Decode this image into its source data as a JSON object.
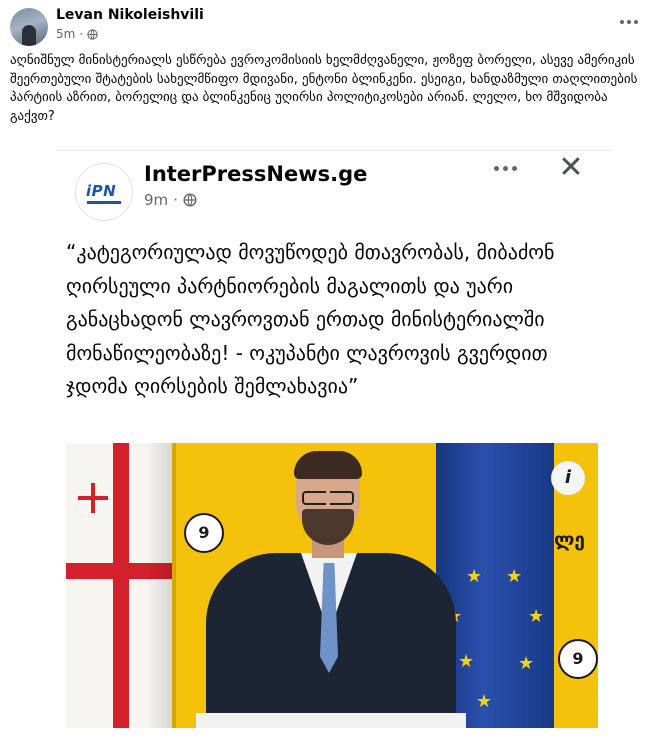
{
  "post": {
    "author": "Levan Nikoleishvili",
    "time": "5m",
    "text": "აღნიშნულ მინისტერიალს ესწრება ევროკომისიის ხელმძღვანელი, ჟოზეფ ბორელი, ასევე ამერიკის შეერთებული შტატების სახელმწიფო მდივანი, ენტონი ბლინკენი. ესეიგი, ხანდაზმული თაღლითების პარტიის აზრით, ბორელიც და ბლინკენიც უღირსი პოლიტიკოსები არიან. ლელო, ხო მშვიდობა გაქვთ?",
    "icons": {
      "more": "more-dots-icon",
      "audience": "globe-icon"
    }
  },
  "shared": {
    "page_name": "InterPressNews.ge",
    "time": "9m",
    "logo_text": "iPN",
    "quote": "“კატეგორიულად მოვუწოდებ მთავრობას, მიბაძონ ღირსეული პარტნიორების მაგალითს და უარი განაცხადონ ლავროვთან ერთად მინისტერიალში მონაწილეობაზე! - ოკუპანტი ლავროვის გვერდით ჯდომა ღირსების შემლახავია”",
    "photo": {
      "badge_left": "9",
      "badge_right": "9",
      "info_icon": "i",
      "wall_text": "ლე",
      "description_icons": [
        "georgia-flag",
        "eu-flag",
        "speaker-photo"
      ]
    },
    "icons": {
      "more": "more-dots-icon",
      "close": "close-icon",
      "audience": "globe-icon"
    }
  },
  "colors": {
    "accent_blue": "#1d56a8",
    "ipn_red": "#d42b2b",
    "wall_yellow": "#f4c20a",
    "eu_blue": "#1e47a8"
  }
}
